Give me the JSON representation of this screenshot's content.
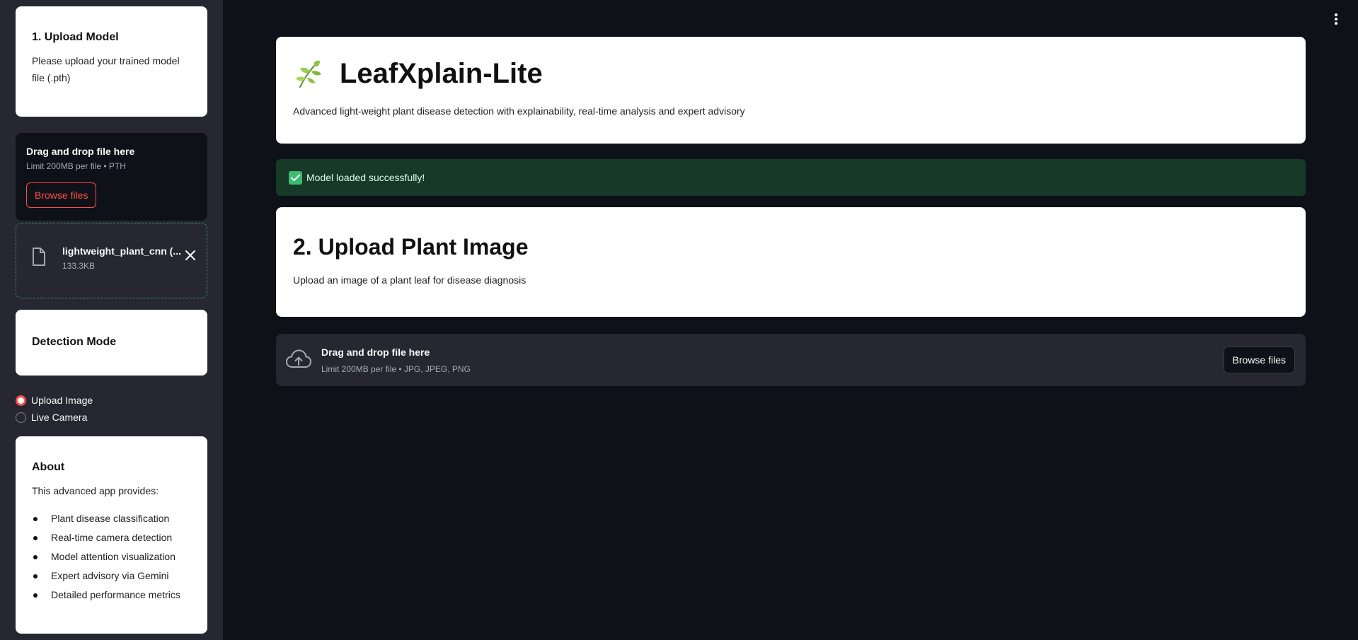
{
  "sidebar": {
    "upload_model": {
      "title": "1. Upload Model",
      "text": "Please upload your trained model file (.pth)"
    },
    "model_dropzone": {
      "title": "Drag and drop file here",
      "subtitle": "Limit 200MB per file • PTH",
      "browse_label": "Browse files"
    },
    "uploaded_file": {
      "name": "lightweight_plant_cnn (...",
      "size": "133.3KB"
    },
    "detection_mode": {
      "title": "Detection Mode",
      "options": [
        "Upload Image",
        "Live Camera"
      ],
      "selected": "Upload Image"
    },
    "about": {
      "title": "About",
      "intro": "This advanced app provides:",
      "items": [
        "Plant disease classification",
        "Real-time camera detection",
        "Model attention visualization",
        "Expert advisory via Gemini",
        "Detailed performance metrics"
      ]
    }
  },
  "main": {
    "app_title": "LeafXplain-Lite",
    "app_description": "Advanced light-weight plant disease detection with explainability, real-time analysis and expert advisory",
    "success_message": "Model loaded successfully!",
    "section2": {
      "title": "2. Upload Plant Image",
      "text": "Upload an image of a plant leaf for disease diagnosis"
    },
    "image_dropzone": {
      "title": "Drag and drop file here",
      "subtitle": "Limit 200MB per file • JPG, JPEG, PNG",
      "browse_label": "Browse files"
    }
  },
  "icons": {
    "leaf": "seedling-icon",
    "file": "file-icon",
    "close": "close-icon",
    "cloud": "cloud-upload-icon",
    "check": "check-icon",
    "menu": "kebab-menu-icon"
  },
  "colors": {
    "accent": "#ff4b4b",
    "success_bg": "#173928",
    "success_check": "#3dbb6e"
  }
}
